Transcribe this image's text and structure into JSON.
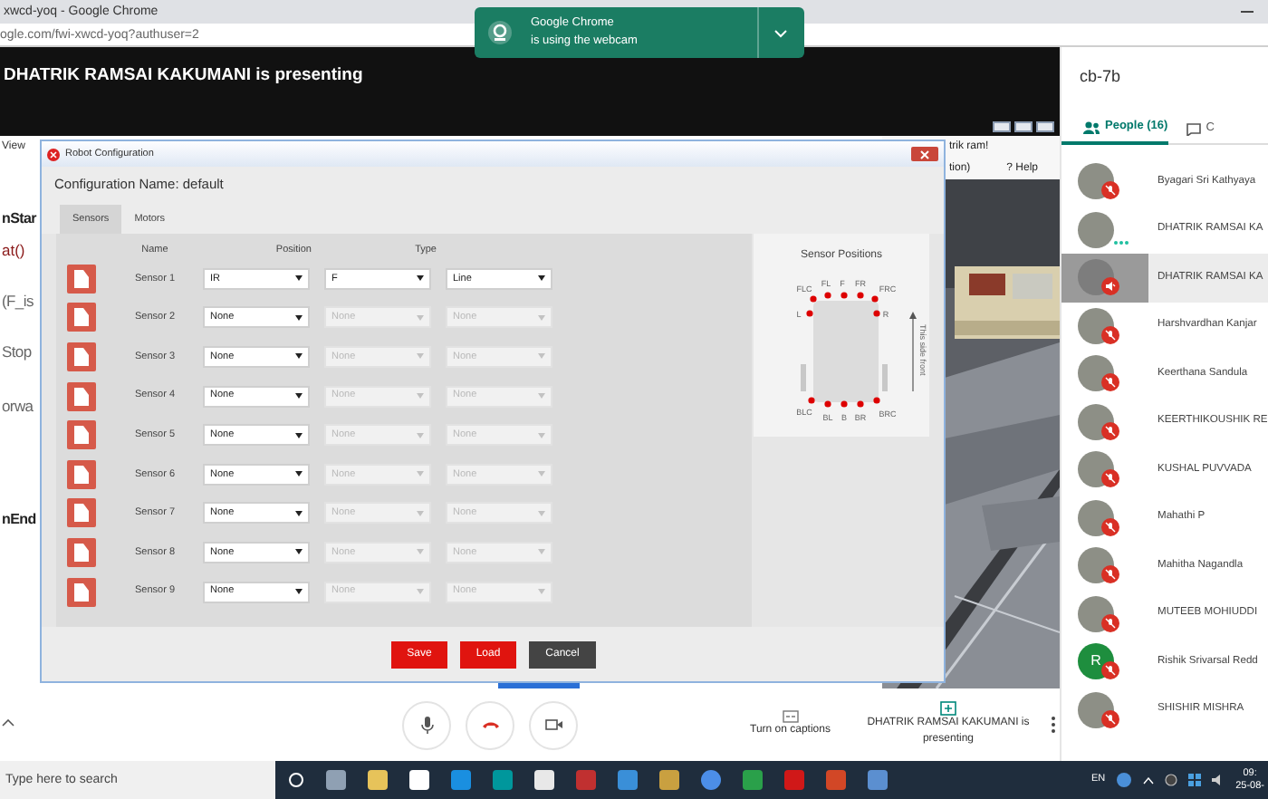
{
  "browser": {
    "title": "xwcd-yoq - Google Chrome",
    "address": "ogle.com/fwi-xwcd-yoq?authuser=2"
  },
  "notification": {
    "title": "Google Chrome",
    "text": "is using the webcam"
  },
  "presenter_banner": "DHATRIK RAMSAI KAKUMANI is presenting",
  "shared_screen": {
    "code_fragments": [
      {
        "text": "View",
        "kind": "menu"
      },
      {
        "text": "nStar",
        "kind": "keyword"
      },
      {
        "text": "at()",
        "kind": "call"
      },
      {
        "text": "(F_is",
        "kind": "plain"
      },
      {
        "text": "Stop",
        "kind": "plain"
      },
      {
        "text": "orwa",
        "kind": "plain"
      },
      {
        "text": "nEnd",
        "kind": "keyword"
      }
    ],
    "sim_header": "trik ram!",
    "sim_toolbar": [
      "tion)",
      "? Help"
    ],
    "dialog": {
      "title": "Robot Configuration",
      "config_label": "Configuration Name: default",
      "tabs": [
        {
          "label": "Sensors",
          "selected": true
        },
        {
          "label": "Motors",
          "selected": false
        }
      ],
      "columns": [
        "Name",
        "Position",
        "Type"
      ],
      "sensors": [
        {
          "name": "Sensor 1",
          "selects": [
            {
              "value": "IR",
              "disabled": false
            },
            {
              "value": "F",
              "disabled": false
            },
            {
              "value": "Line",
              "disabled": false
            }
          ]
        },
        {
          "name": "Sensor 2",
          "selects": [
            {
              "value": "None",
              "disabled": false
            },
            {
              "value": "None",
              "disabled": true
            },
            {
              "value": "None",
              "disabled": true
            }
          ]
        },
        {
          "name": "Sensor 3",
          "selects": [
            {
              "value": "None",
              "disabled": false
            },
            {
              "value": "None",
              "disabled": true
            },
            {
              "value": "None",
              "disabled": true
            }
          ]
        },
        {
          "name": "Sensor 4",
          "selects": [
            {
              "value": "None",
              "disabled": false
            },
            {
              "value": "None",
              "disabled": true
            },
            {
              "value": "None",
              "disabled": true
            }
          ]
        },
        {
          "name": "Sensor 5",
          "selects": [
            {
              "value": "None",
              "disabled": false
            },
            {
              "value": "None",
              "disabled": true
            },
            {
              "value": "None",
              "disabled": true
            }
          ]
        },
        {
          "name": "Sensor 6",
          "selects": [
            {
              "value": "None",
              "disabled": false
            },
            {
              "value": "None",
              "disabled": true
            },
            {
              "value": "None",
              "disabled": true
            }
          ]
        },
        {
          "name": "Sensor 7",
          "selects": [
            {
              "value": "None",
              "disabled": false
            },
            {
              "value": "None",
              "disabled": true
            },
            {
              "value": "None",
              "disabled": true
            }
          ]
        },
        {
          "name": "Sensor 8",
          "selects": [
            {
              "value": "None",
              "disabled": false
            },
            {
              "value": "None",
              "disabled": true
            },
            {
              "value": "None",
              "disabled": true
            }
          ]
        },
        {
          "name": "Sensor 9",
          "selects": [
            {
              "value": "None",
              "disabled": false
            },
            {
              "value": "None",
              "disabled": true
            },
            {
              "value": "None",
              "disabled": true
            }
          ]
        }
      ],
      "positions_panel": {
        "title": "Sensor Positions",
        "labels": [
          "FLC",
          "FL",
          "F",
          "FR",
          "FRC",
          "L",
          "R",
          "BLC",
          "BL",
          "B",
          "BR",
          "BRC"
        ],
        "front_label": "This side front"
      },
      "buttons": [
        {
          "label": "Save",
          "kind": "primary"
        },
        {
          "label": "Load",
          "kind": "primary"
        },
        {
          "label": "Cancel",
          "kind": "secondary"
        }
      ]
    }
  },
  "meeting_bar": {
    "captions": "Turn on captions",
    "presenting": "DHATRIK RAMSAI KAKUMANI is presenting"
  },
  "side_panel": {
    "meeting_code": "cb-7b",
    "tabs": [
      {
        "label": "People (16)",
        "selected": true
      },
      {
        "label": "C",
        "selected": false
      }
    ],
    "participants": [
      {
        "name": "Byagari Sri Kathyaya",
        "kind": "muted",
        "selected": false
      },
      {
        "name": "DHATRIK RAMSAI KA",
        "kind": "presenting",
        "selected": false
      },
      {
        "name": "DHATRIK RAMSAI KA",
        "kind": "speaker",
        "selected": true
      },
      {
        "name": "Harshvardhan Kanjar",
        "kind": "muted",
        "selected": false
      },
      {
        "name": "Keerthana Sandula",
        "kind": "muted",
        "selected": false
      },
      {
        "name": "KEERTHIKOUSHIK RE",
        "kind": "muted",
        "selected": false
      },
      {
        "name": "KUSHAL PUVVADA",
        "kind": "muted",
        "selected": false
      },
      {
        "name": "Mahathi P",
        "kind": "muted",
        "selected": false
      },
      {
        "name": "Mahitha Nagandla",
        "kind": "muted",
        "selected": false
      },
      {
        "name": "MUTEEB MOHIUDDI",
        "kind": "muted",
        "selected": false
      },
      {
        "name": "Rishik Srivarsal Redd",
        "kind": "muted",
        "selected": false,
        "initial": "R"
      },
      {
        "name": "SHISHIR MISHRA",
        "kind": "muted",
        "selected": false
      }
    ]
  },
  "taskbar": {
    "search_placeholder": "Type here to search",
    "language": "EN",
    "clock": [
      "09:",
      "25-08-"
    ]
  }
}
